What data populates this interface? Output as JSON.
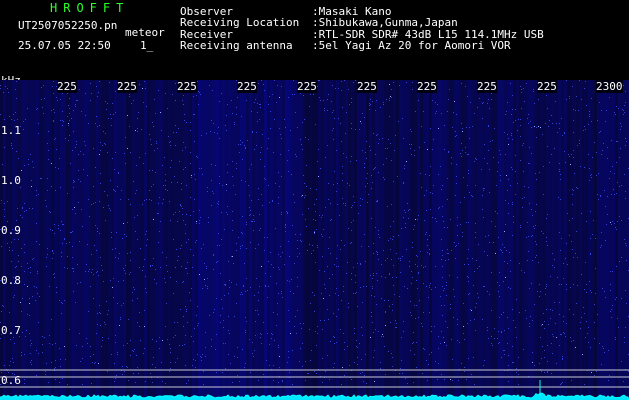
{
  "header": {
    "brand": "HROFFT",
    "filename": "UT2507052250.pn",
    "meteor_label": "meteor",
    "datetime": "25.07.05 22:50",
    "count": "1_"
  },
  "meta": [
    {
      "label": "Observer",
      "value": ":Masaki Kano"
    },
    {
      "label": "Receiving Location",
      "value": ":Shibukawa,Gunma,Japan"
    },
    {
      "label": "Receiver",
      "value": ":RTL-SDR SDR# 43dB L15 114.1MHz USB"
    },
    {
      "label": "Receiving antenna",
      "value": ":5el Yagi Az 20 for Aomori VOR"
    }
  ],
  "axis": {
    "y_unit": "kHz",
    "x_ticks": [
      "225",
      "225",
      "225",
      "225",
      "225",
      "225",
      "225",
      "225",
      "225",
      "2300"
    ],
    "y_ticks": [
      "1.1",
      "1.0",
      "0.9",
      "0.8",
      "0.7",
      "0.6"
    ]
  },
  "colors": {
    "background": "#000000",
    "spectrogram": "#0a0a5a",
    "noise": "#3a4aff",
    "trace": "#00ffff",
    "brand": "#2aff2a"
  }
}
